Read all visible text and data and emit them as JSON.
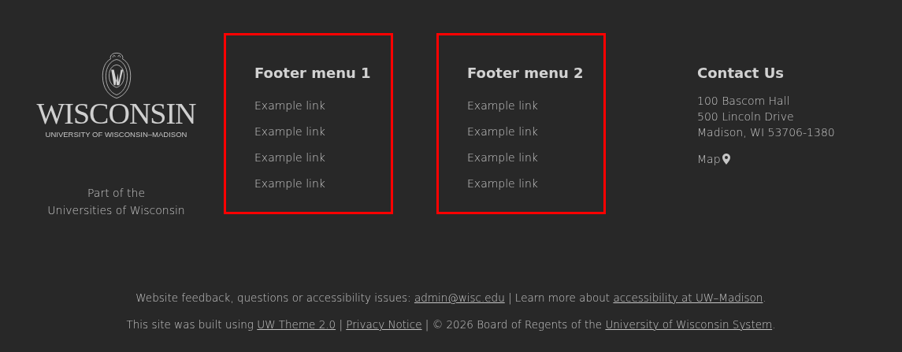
{
  "logo": {
    "wordmark": "WISCONSIN",
    "subtitle": "UNIVERSITY OF WISCONSIN–MADISON"
  },
  "affiliation": [
    "Part of the",
    "Universities of Wisconsin"
  ],
  "menus": [
    {
      "title": "Footer menu 1",
      "highlighted": true,
      "links": [
        "Example link",
        "Example link",
        "Example link",
        "Example link"
      ]
    },
    {
      "title": "Footer menu 2",
      "highlighted": true,
      "links": [
        "Example link",
        "Example link",
        "Example link",
        "Example link"
      ]
    }
  ],
  "contact": {
    "title": "Contact Us",
    "address": [
      "100 Bascom Hall",
      "500 Lincoln Drive",
      "Madison, WI 53706-1380"
    ],
    "map_link": "Map"
  },
  "footer_lines": [
    [
      {
        "kind": "text",
        "text": "Website feedback, questions or accessibility issues: "
      },
      {
        "kind": "link",
        "text": "admin@wisc.edu"
      },
      {
        "kind": "text",
        "text": " | Learn more about "
      },
      {
        "kind": "link",
        "text": "accessibility at UW–Madison"
      },
      {
        "kind": "text",
        "text": "."
      }
    ],
    [
      {
        "kind": "text",
        "text": "This site was built using "
      },
      {
        "kind": "link",
        "text": "UW Theme 2.0"
      },
      {
        "kind": "text",
        "text": " | "
      },
      {
        "kind": "link",
        "text": "Privacy Notice"
      },
      {
        "kind": "text",
        "text": " | © 2026 Board of Regents of the "
      },
      {
        "kind": "link",
        "text": "University of Wisconsin System"
      },
      {
        "kind": "text",
        "text": "."
      }
    ]
  ]
}
